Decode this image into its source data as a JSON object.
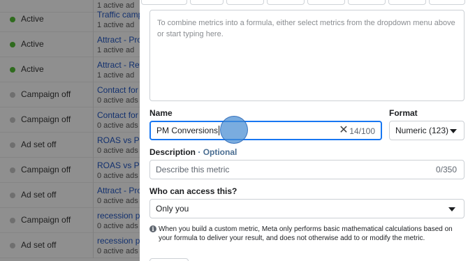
{
  "background_table": {
    "rows": [
      {
        "status": "",
        "status_on": false,
        "name": "",
        "sub": "1 active ad"
      },
      {
        "status": "Active",
        "status_on": true,
        "name": "Traffic camp",
        "sub": "1 active ad"
      },
      {
        "status": "Active",
        "status_on": true,
        "name": "Attract - Pros",
        "sub": "1 active ad"
      },
      {
        "status": "Active",
        "status_on": true,
        "name": "Attract - Reta",
        "sub": "1 active ad"
      },
      {
        "status": "Campaign off",
        "status_on": false,
        "name": "Contact for c",
        "sub": "0 active ads"
      },
      {
        "status": "Campaign off",
        "status_on": false,
        "name": "Contact for c",
        "sub": "0 active ads"
      },
      {
        "status": "Ad set off",
        "status_on": false,
        "name": "ROAS vs PO",
        "sub": "0 active ads"
      },
      {
        "status": "Campaign off",
        "status_on": false,
        "name": "ROAS vs PO",
        "sub": "0 active ads"
      },
      {
        "status": "Ad set off",
        "status_on": false,
        "name": "Attract - Pros",
        "sub": "0 active ads"
      },
      {
        "status": "Campaign off",
        "status_on": false,
        "name": "recession pr",
        "sub": "0 active ads"
      },
      {
        "status": "Ad set off",
        "status_on": false,
        "name": "recession pr",
        "sub": "0 active ads"
      }
    ]
  },
  "formula": {
    "placeholder": "To combine metrics into a formula, either select metrics from the dropdown menu above or start typing here."
  },
  "name_field": {
    "label": "Name",
    "value": "PM Conversions",
    "char_count": "14/100",
    "clear_icon": "close-icon"
  },
  "format_field": {
    "label": "Format",
    "value": "Numeric (123)"
  },
  "description_field": {
    "label": "Description",
    "separator": " · ",
    "optional": "Optional",
    "placeholder": "Describe this metric",
    "char_count": "0/350"
  },
  "access_field": {
    "label": "Who can access this?",
    "value": "Only you"
  },
  "info": {
    "icon": "info-icon",
    "text": "When you build a custom metric, Meta only performs basic mathematical calculations based on your formula to deliver your result, and does not otherwise add to or modify the metric."
  },
  "colors": {
    "accent": "#1877f2",
    "status_active": "#2f6b1e",
    "link": "#12306e",
    "click_indicator": "#468cd2"
  }
}
